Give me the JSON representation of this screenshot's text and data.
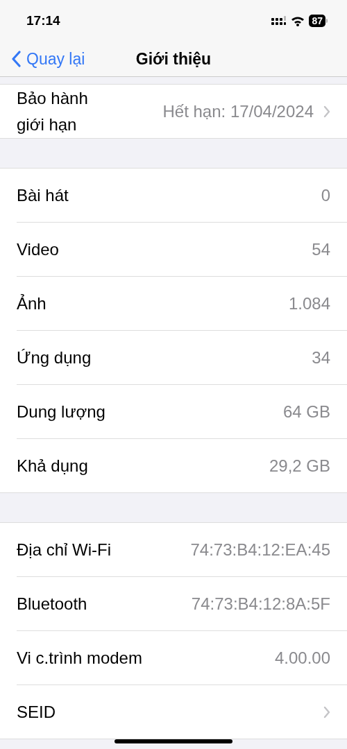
{
  "status_bar": {
    "time": "17:14",
    "battery": "87"
  },
  "nav": {
    "back": "Quay lại",
    "title": "Giới thiệu"
  },
  "sections": [
    {
      "rows": [
        {
          "label": "Bảo hành giới hạn",
          "value": "Hết hạn: 17/04/2024",
          "chevron": true
        }
      ]
    },
    {
      "rows": [
        {
          "label": "Bài hát",
          "value": "0",
          "chevron": false
        },
        {
          "label": "Video",
          "value": "54",
          "chevron": false
        },
        {
          "label": "Ảnh",
          "value": "1.084",
          "chevron": false
        },
        {
          "label": "Ứng dụng",
          "value": "34",
          "chevron": false
        },
        {
          "label": "Dung lượng",
          "value": "64 GB",
          "chevron": false
        },
        {
          "label": "Khả dụng",
          "value": "29,2 GB",
          "chevron": false
        }
      ]
    },
    {
      "rows": [
        {
          "label": "Địa chỉ Wi-Fi",
          "value": "74:73:B4:12:EA:45",
          "chevron": false
        },
        {
          "label": "Bluetooth",
          "value": "74:73:B4:12:8A:5F",
          "chevron": false
        },
        {
          "label": "Vi c.trình modem",
          "value": "4.00.00",
          "chevron": false
        },
        {
          "label": "SEID",
          "chevron": true
        }
      ]
    }
  ]
}
